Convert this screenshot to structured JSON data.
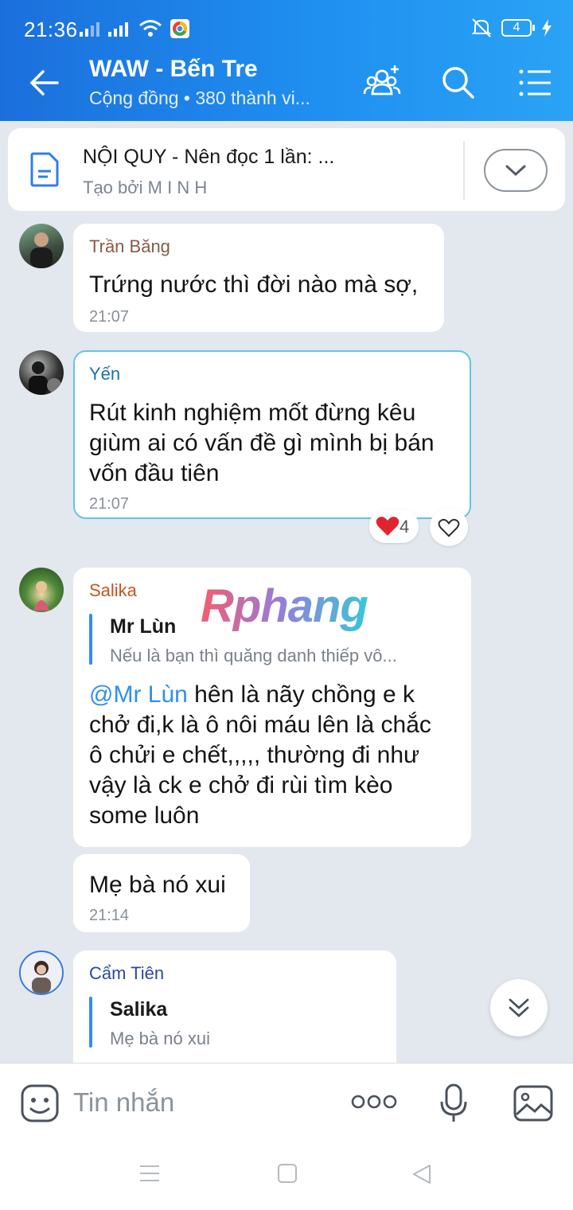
{
  "status": {
    "time": "21:36",
    "battery": "4"
  },
  "header": {
    "title": "WAW - Bến Tre",
    "subtitle": "Cộng đồng • 380 thành vi..."
  },
  "pinned": {
    "title": "NỘI QUY - Nên đọc 1 lần: ...",
    "creator": "Tạo bởi M I N H"
  },
  "messages": [
    {
      "sender": "Trần Băng",
      "text": "Trứng nước thì đời nào mà sợ,",
      "time": "21:07"
    },
    {
      "sender": "Yến",
      "lines": [
        "Rút kinh nghiệm mốt đừng kêu",
        "giùm ai có vấn đề gì mình bị bán",
        "vốn đầu tiên"
      ],
      "time": "21:07",
      "reaction_count": "4"
    },
    {
      "sender": "Salika",
      "quote_name": "Mr Lùn",
      "quote_text": "Nếu là bạn thì quăng danh thiếp vô...",
      "mention": "@Mr Lùn",
      "line1_rest": " hên là nãy chồng e k",
      "lines": [
        "chở đi,k là ô nôi máu lên là chắc",
        "ô chửi e chết,,,,, thường đi như",
        "vậy là ck e chở đi rùi tìm kèo",
        "some luôn"
      ]
    },
    {
      "text": "Mẹ bà nó xui",
      "time": "21:14"
    },
    {
      "sender": "Cẩm Tiên",
      "quote_name": "Salika",
      "quote_text": "Mẹ bà nó xui"
    }
  ],
  "watermark": "Rphang",
  "input": {
    "placeholder": "Tin nhắn"
  },
  "colors": {
    "header_start": "#1b6fdc",
    "header_end": "#2aa3f5",
    "accent": "#2f8ff0",
    "background": "#e3e8ef"
  }
}
